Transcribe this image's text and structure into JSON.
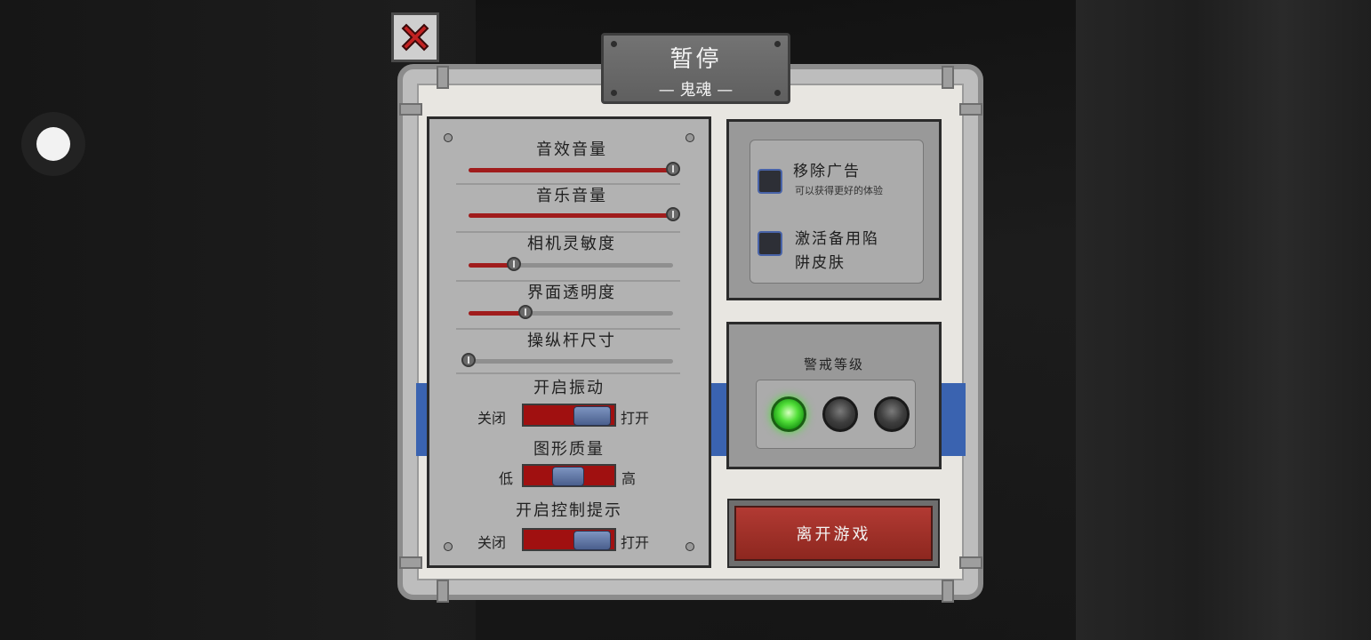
{
  "header": {
    "title": "暂停",
    "subtitle": "— 鬼魂 —"
  },
  "close": {
    "icon": "close-x-icon"
  },
  "sliders": [
    {
      "label": "音效音量",
      "value": 1.0
    },
    {
      "label": "音乐音量",
      "value": 1.0
    },
    {
      "label": "相机灵敏度",
      "value": 0.22
    },
    {
      "label": "界面透明度",
      "value": 0.28
    },
    {
      "label": "操纵杆尺寸",
      "value": 0.0
    }
  ],
  "toggles": {
    "vibration": {
      "title": "开启振动",
      "left": "关闭",
      "right": "打开"
    },
    "graphics": {
      "title": "图形质量",
      "left": "低",
      "right": "高"
    },
    "hints": {
      "title": "开启控制提示",
      "left": "关闭",
      "right": "打开"
    }
  },
  "options": {
    "remove_ads": "移除广告",
    "remove_ads_sub": "可以获得更好的体验",
    "trap_skin_line1": "激活备用陷",
    "trap_skin_line2": "阱皮肤"
  },
  "alert": {
    "title": "警戒等级",
    "active_level": 1,
    "levels": 3
  },
  "leave_button": "离开游戏",
  "colors": {
    "accent_red": "#a01c1c",
    "stripe_blue": "#3a63b0",
    "lamp_green": "#53e03a"
  }
}
